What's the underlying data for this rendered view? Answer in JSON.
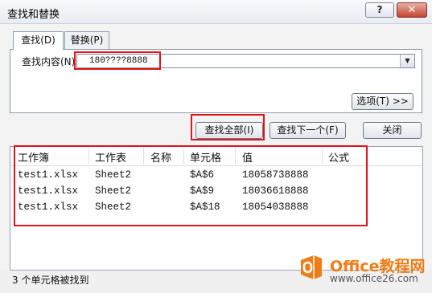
{
  "window": {
    "title": "查找和替换",
    "help_label": "?",
    "close_label": "✕"
  },
  "tabs": [
    {
      "label": "查找(D)"
    },
    {
      "label": "替换(P)"
    }
  ],
  "find": {
    "label": "查找内容(N):",
    "value": "180????8888",
    "dropdown_icon": "chevron-down-icon"
  },
  "buttons": {
    "options": "选项(T) >>",
    "find_all": "查找全部(I)",
    "find_next": "查找下一个(F)",
    "close": "关闭"
  },
  "results": {
    "columns": [
      "工作簿",
      "工作表",
      "名称",
      "单元格",
      "值",
      "公式"
    ],
    "rows": [
      [
        "test1.xlsx",
        "Sheet2",
        "",
        "$A$6",
        "18058738888",
        ""
      ],
      [
        "test1.xlsx",
        "Sheet2",
        "",
        "$A$9",
        "18036618888",
        ""
      ],
      [
        "test1.xlsx",
        "Sheet2",
        "",
        "$A$18",
        "18054038888",
        ""
      ]
    ]
  },
  "status": "3 个单元格被找到",
  "watermark": {
    "name": "Office教程网",
    "url": "www.office26.com",
    "brand_color": "#f07c16",
    "highlight_color": "#e0151b"
  }
}
